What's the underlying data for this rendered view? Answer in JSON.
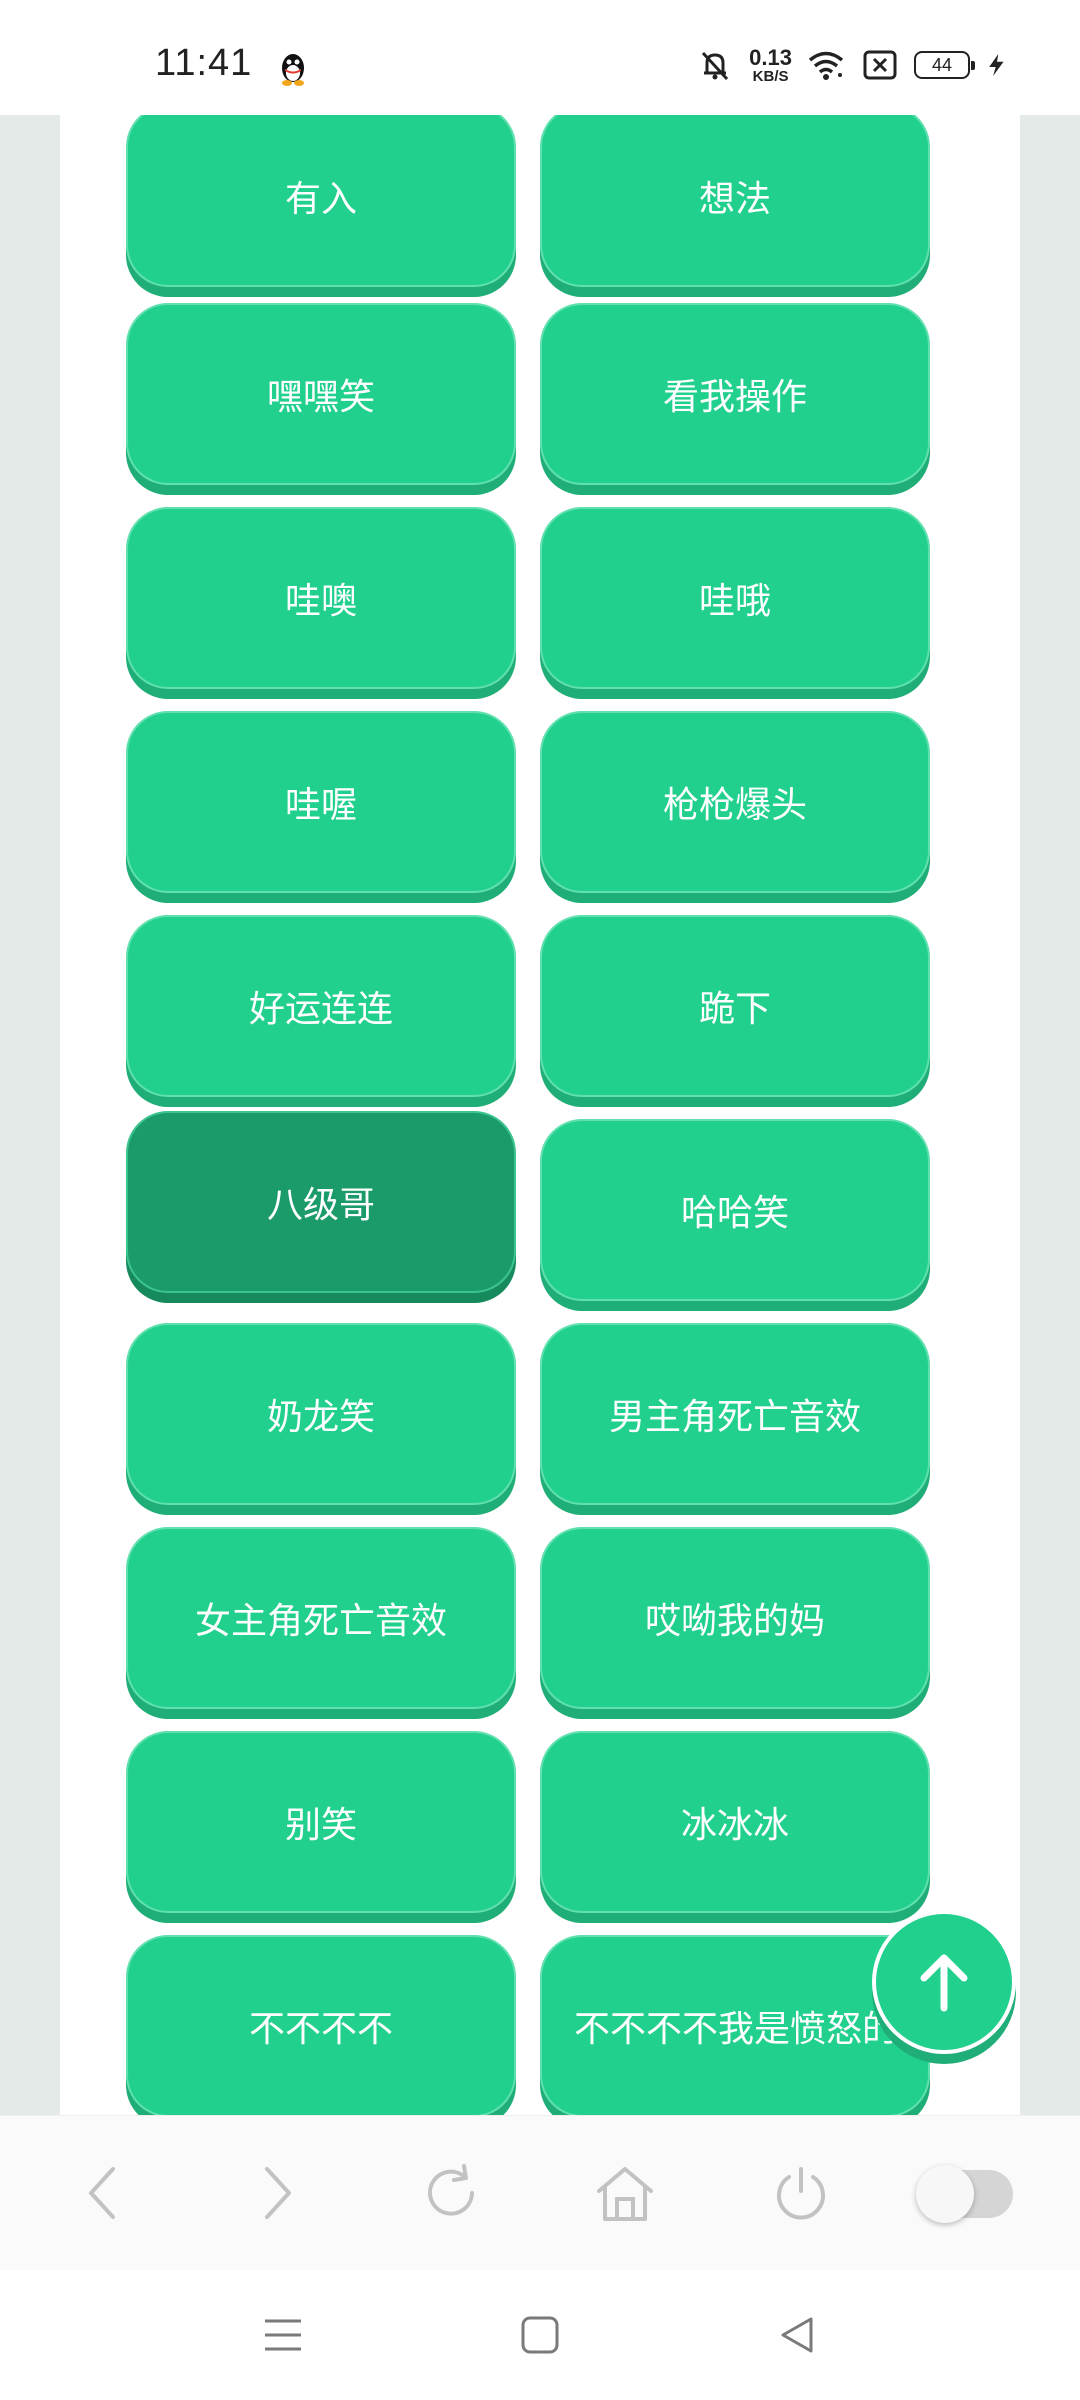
{
  "status_bar": {
    "time": "11:41",
    "net_speed_value": "0.13",
    "net_speed_unit": "KB/S",
    "battery_level": "44",
    "icons": [
      "qq-icon",
      "mute-bell-icon",
      "wifi-icon",
      "close-box-icon",
      "battery-icon",
      "charging-icon"
    ]
  },
  "sound_buttons": [
    {
      "label": "有入"
    },
    {
      "label": "想法"
    },
    {
      "label": "嘿嘿笑"
    },
    {
      "label": "看我操作"
    },
    {
      "label": "哇噢"
    },
    {
      "label": "哇哦"
    },
    {
      "label": "哇喔"
    },
    {
      "label": "枪枪爆头"
    },
    {
      "label": "好运连连"
    },
    {
      "label": "跪下"
    },
    {
      "label": "八级哥",
      "state": "pressed"
    },
    {
      "label": "哈哈笑"
    },
    {
      "label": "奶龙笑"
    },
    {
      "label": "男主角死亡音效"
    },
    {
      "label": "女主角死亡音效"
    },
    {
      "label": "哎呦我的妈"
    },
    {
      "label": "别笑"
    },
    {
      "label": "冰冰冰"
    },
    {
      "label": "不不不不"
    },
    {
      "label": "不不不不我是愤怒的"
    }
  ],
  "back_to_top": {
    "icon": "arrow-up-icon"
  },
  "browser_toolbar": {
    "icons": [
      "back-icon",
      "forward-icon",
      "refresh-icon",
      "home-icon",
      "power-icon",
      "toggle-switch"
    ]
  },
  "system_nav": {
    "icons": [
      "menu-icon",
      "home-square-icon",
      "back-triangle-icon"
    ]
  },
  "colors": {
    "button_green": "#22d08e",
    "button_pressed": "#1b9b6a",
    "side_bg": "#e4eae7"
  }
}
